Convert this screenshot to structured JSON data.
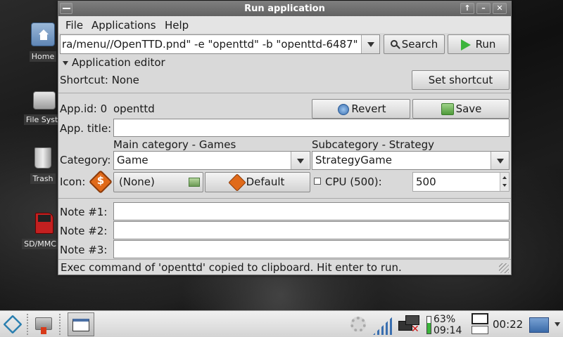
{
  "window": {
    "title": "Run application",
    "menu": [
      "File",
      "Applications",
      "Help"
    ],
    "command": "ra/menu//OpenTTD.pnd\" -e \"openttd\" -b \"openttd-6487\"",
    "search_label": "Search",
    "run_label": "Run",
    "editor_heading": "Application editor",
    "shortcut_label": "Shortcut: None",
    "set_shortcut_label": "Set shortcut",
    "appid_label": "App.id: 0",
    "appid_value": "openttd",
    "revert_label": "Revert",
    "save_label": "Save",
    "apptitle_label": "App. title:",
    "apptitle_value": "",
    "category_label": "Category:",
    "main_category_heading": "Main category - Games",
    "main_category_value": "Game",
    "subcategory_heading": "Subcategory - Strategy",
    "subcategory_value": "StrategyGame",
    "icon_label": "Icon:",
    "icon_value": "(None)",
    "default_label": "Default",
    "cpu_label": "CPU (500):",
    "cpu_checked": false,
    "cpu_value": "500",
    "note1_label": "Note #1:",
    "note2_label": "Note #2:",
    "note3_label": "Note #3:",
    "note1_value": "",
    "note2_value": "",
    "note3_value": "",
    "status": "Exec command of 'openttd' copied to clipboard. Hit enter to run."
  },
  "desktop_icons": [
    {
      "label": "Home",
      "icon": "home-folder-icon"
    },
    {
      "label": "File Syste",
      "icon": "hard-drive-icon"
    },
    {
      "label": "Trash",
      "icon": "trash-icon"
    },
    {
      "label": "SD/MMC D",
      "icon": "sd-card-icon"
    }
  ],
  "taskbar": {
    "battery_percent": "63%",
    "battery_time": "09:14",
    "clock": "00:22"
  },
  "colors": {
    "titlebar": "#6e6e6e",
    "window_bg": "#d9d9d9",
    "run_icon": "#3cb43c",
    "dollar_icon": "#e06a1a"
  }
}
